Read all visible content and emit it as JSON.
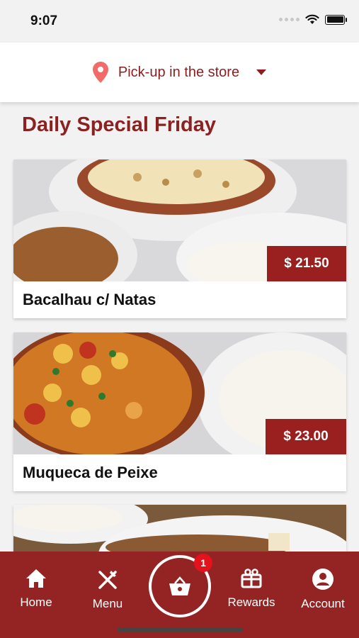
{
  "status": {
    "time": "9:07"
  },
  "pickup": {
    "label": "Pick-up in the store",
    "icon": "location-pin-icon",
    "accent": "#f26b6b"
  },
  "section": {
    "title": "Daily Special Friday"
  },
  "items": [
    {
      "name": "Bacalhau c/ Natas",
      "price": "$ 21.50"
    },
    {
      "name": "Muqueca de Peixe",
      "price": "$ 23.00"
    }
  ],
  "tabs": [
    {
      "label": "Home",
      "icon": "home-icon"
    },
    {
      "label": "Menu",
      "icon": "fork-knife-icon"
    },
    {
      "label": "",
      "icon": "basket-icon",
      "badge": "1"
    },
    {
      "label": "Rewards",
      "icon": "gift-icon"
    },
    {
      "label": "Account",
      "icon": "account-icon"
    }
  ],
  "colors": {
    "brand": "#942323",
    "title": "#8b2222",
    "badge": "#e3121b"
  }
}
